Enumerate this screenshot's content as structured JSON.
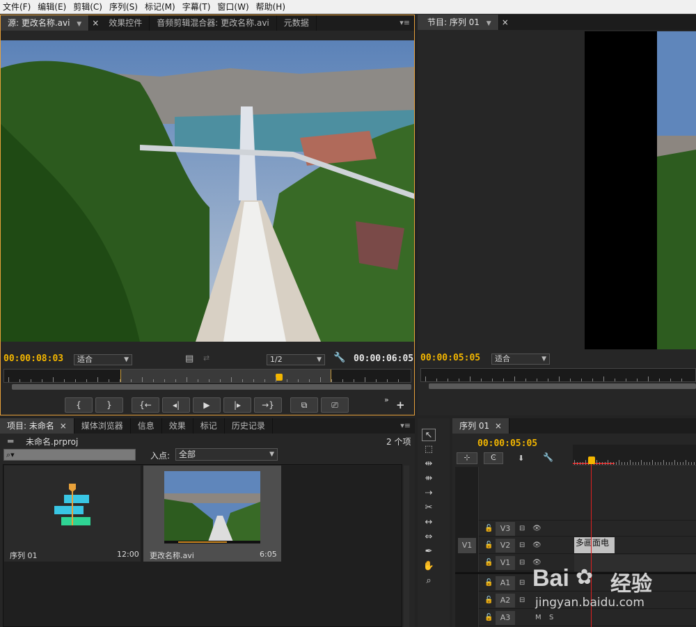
{
  "menu": [
    "文件(F)",
    "编辑(E)",
    "剪辑(C)",
    "序列(S)",
    "标记(M)",
    "字幕(T)",
    "窗口(W)",
    "帮助(H)"
  ],
  "source_panel": {
    "tabs": [
      "源: 更改名称.avi",
      "效果控件",
      "音频剪辑混合器: 更改名称.avi",
      "元数据"
    ],
    "timecode_left": "00:00:08:03",
    "fit": "适合",
    "resolution": "1/2",
    "timecode_right": "00:00:06:05"
  },
  "program_panel": {
    "tab": "节目: 序列 01",
    "timecode": "00:00:05:05",
    "fit": "适合"
  },
  "project_panel": {
    "tabs": [
      "项目: 未命名",
      "媒体浏览器",
      "信息",
      "效果",
      "标记",
      "历史记录"
    ],
    "project_file": "未命名.prproj",
    "item_count": "2 个项",
    "inpoint_label": "入点:",
    "inpoint_value": "全部",
    "items": [
      {
        "name": "序列 01",
        "duration": "12:00"
      },
      {
        "name": "更改名称.avi",
        "duration": "6:05"
      }
    ]
  },
  "timeline_panel": {
    "tab": "序列 01",
    "timecode": "00:00:05:05",
    "video_tracks": [
      "V3",
      "V2",
      "V1"
    ],
    "source_patch": "V1",
    "audio_tracks": [
      "A1",
      "A2",
      "A3"
    ],
    "clip_label": "多画面电",
    "mute_label": "M",
    "solo_label": "S"
  },
  "watermark": {
    "brand_text": "Bai",
    "cn_text": "经验",
    "url": "jingyan.baidu.com"
  },
  "colors": {
    "timecode_yellow": "#f3b600",
    "playhead_red": "#e02020",
    "sequence_cyan": "#39c6e4",
    "sequence_green": "#2fd494",
    "active_border": "#e8a13a"
  }
}
